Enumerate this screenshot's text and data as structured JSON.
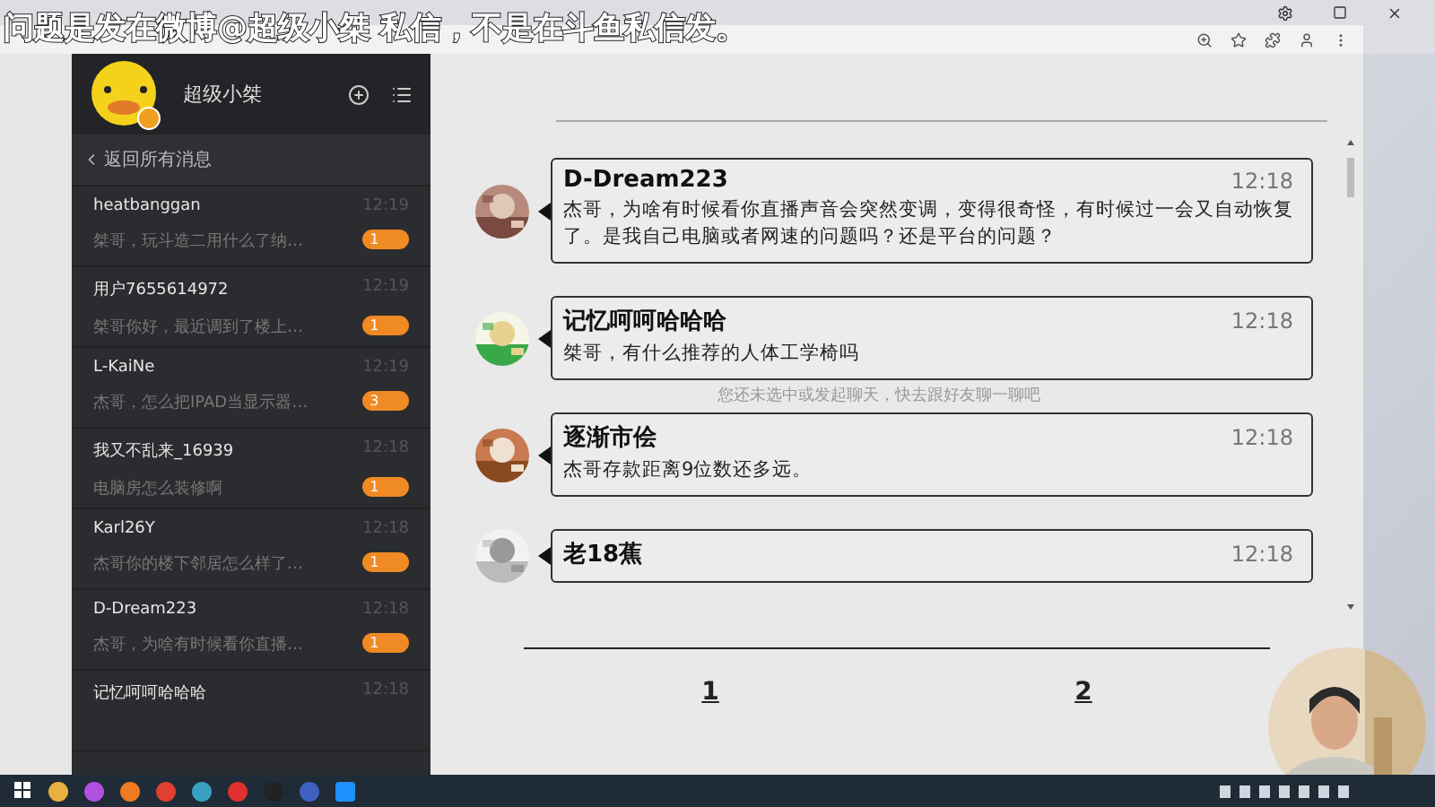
{
  "caption": "问题是发在微博@超级小桀 私信，不是在斗鱼私信发。",
  "profile": {
    "name": "超级小桀"
  },
  "back_link": "返回所有消息",
  "conversations": [
    {
      "name": "heatbanggan",
      "time": "12:19",
      "preview": "桀哥，玩斗造二用什么了纳…",
      "unread": "1"
    },
    {
      "name": "用户7655614972",
      "time": "12:19",
      "preview": "桀哥你好，最近调到了楼上…",
      "unread": "1"
    },
    {
      "name": "L-KaiNe",
      "time": "12:19",
      "preview": "杰哥，怎么把IPAD当显示器…",
      "unread": "3"
    },
    {
      "name": "我又不乱来_16939",
      "time": "12:18",
      "preview": "电脑房怎么装修啊",
      "unread": "1"
    },
    {
      "name": "Karl26Y",
      "time": "12:18",
      "preview": "杰哥你的楼下邻居怎么样了…",
      "unread": "1"
    },
    {
      "name": "D-Dream223",
      "time": "12:18",
      "preview": "杰哥，为啥有时候看你直播…",
      "unread": "1"
    },
    {
      "name": "记忆呵呵哈哈哈",
      "time": "12:18"
    }
  ],
  "empty_hint": "您还未选中或发起聊天，快去跟好友聊一聊吧",
  "messages": [
    {
      "name": "D-Dream223",
      "time": "12:18",
      "text": "杰哥，为啥有时候看你直播声音会突然变调，变得很奇怪，有时候过一会又自动恢复了。是我自己电脑或者网速的问题吗？还是平台的问题？"
    },
    {
      "name": "记忆呵呵哈哈哈",
      "time": "12:18",
      "text": "桀哥，有什么推荐的人体工学椅吗"
    },
    {
      "name": "逐渐市侩",
      "time": "12:18",
      "text": "杰哥存款距离9位数还多远。"
    },
    {
      "name": "老18蕉",
      "time": "12:18"
    }
  ],
  "pagination": [
    {
      "label": "1"
    },
    {
      "label": "2"
    }
  ]
}
